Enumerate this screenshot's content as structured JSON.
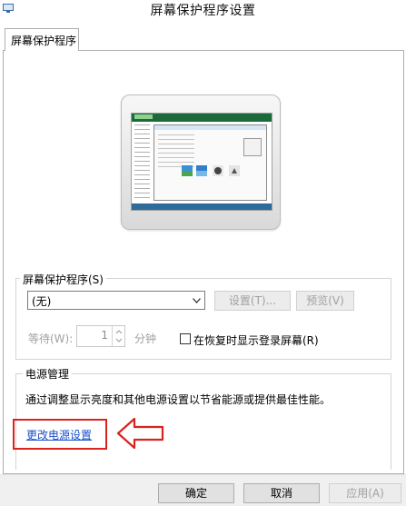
{
  "window": {
    "title": "屏幕保护程序设置"
  },
  "tabs": [
    {
      "label": "屏幕保护程序"
    }
  ],
  "screensaver": {
    "group_label": "屏幕保护程序(S)",
    "selected": "(无)",
    "settings_button": "设置(T)...",
    "preview_button": "预览(V)",
    "wait_label": "等待(W):",
    "wait_value": "1",
    "wait_unit": "分钟",
    "resume_checkbox_label": "在恢复时显示登录屏幕(R)",
    "resume_checked": false
  },
  "power": {
    "group_label": "电源管理",
    "description": "通过调整显示亮度和其他电源设置以节省能源或提供最佳性能。",
    "link_label": "更改电源设置"
  },
  "footer": {
    "ok_label": "确定",
    "cancel_label": "取消",
    "apply_label": "应用(A)"
  },
  "colors": {
    "link": "#1a4fc8",
    "annotation": "#d8231f"
  },
  "icons": {
    "window": "display-settings-icon",
    "dropdown": "chevron-down-icon",
    "annotation": "left-arrow-annotation"
  }
}
